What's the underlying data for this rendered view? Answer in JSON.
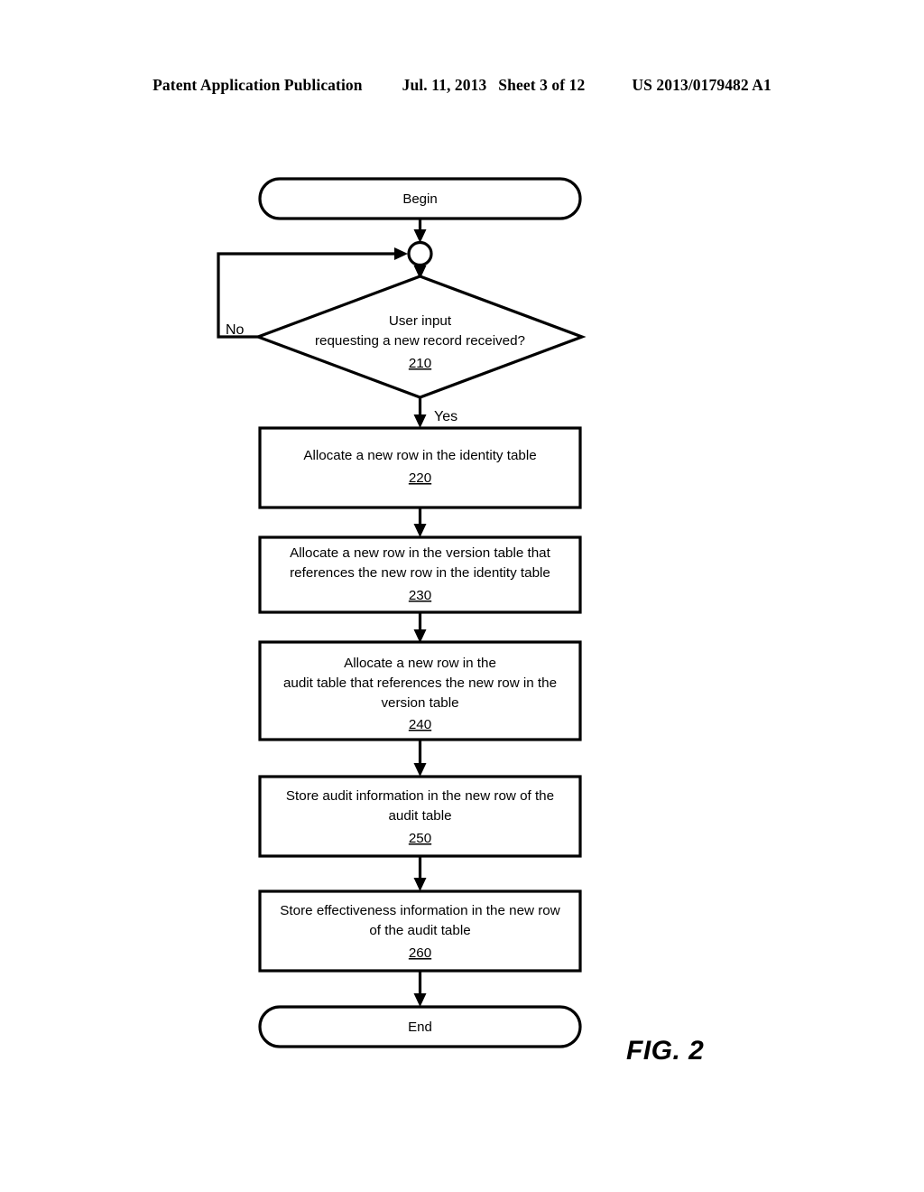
{
  "page_header": {
    "publication": "Patent Application Publication",
    "date": "Jul. 11, 2013",
    "sheet": "Sheet 3 of 12",
    "patent_number": "US 2013/0179482 A1"
  },
  "figure": {
    "caption": "FIG. 2",
    "type": "flowchart"
  },
  "flowchart": {
    "nodes": [
      {
        "id": "begin",
        "shape": "terminator",
        "lines": [
          "Begin"
        ],
        "ref": ""
      },
      {
        "id": "junction",
        "shape": "connector-circle",
        "lines": [],
        "ref": ""
      },
      {
        "id": "decision-210",
        "shape": "decision",
        "lines": [
          "User input",
          "requesting a new record received?"
        ],
        "ref": "210"
      },
      {
        "id": "process-220",
        "shape": "process",
        "lines": [
          "Allocate a new row in the identity table"
        ],
        "ref": "220"
      },
      {
        "id": "process-230",
        "shape": "process",
        "lines": [
          "Allocate a new row in the version table that",
          "references the new row in the identity table"
        ],
        "ref": "230"
      },
      {
        "id": "process-240",
        "shape": "process",
        "lines": [
          "Allocate a new row in the",
          "audit table that references the new row in the",
          "version table"
        ],
        "ref": "240"
      },
      {
        "id": "process-250",
        "shape": "process",
        "lines": [
          "Store audit information in the new row of the",
          "audit table"
        ],
        "ref": "250"
      },
      {
        "id": "process-260",
        "shape": "process",
        "lines": [
          "Store effectiveness information in the new row",
          "of the audit table"
        ],
        "ref": "260"
      },
      {
        "id": "end",
        "shape": "terminator",
        "lines": [
          "End"
        ],
        "ref": ""
      }
    ],
    "branch_labels": {
      "no": "No",
      "yes": "Yes"
    }
  }
}
